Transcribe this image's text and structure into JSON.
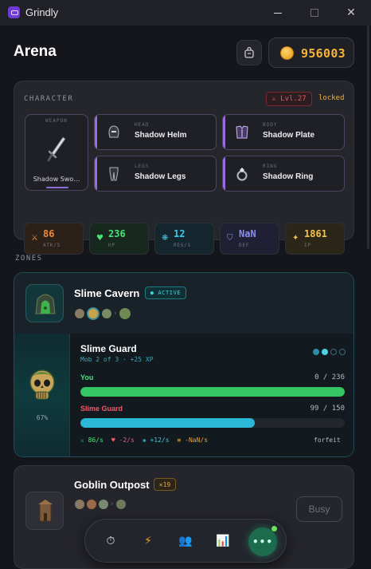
{
  "window": {
    "title": "Grindly",
    "minimize_icon": "minimize-icon",
    "maximize_icon": "maximize-icon",
    "close_glyph": "✕"
  },
  "header": {
    "title": "Arena",
    "coins": "956003",
    "bag_icon": "bag-icon",
    "coin_icon": "coin-icon"
  },
  "character": {
    "section_label": "CHARACTER",
    "level_badge": "⚔ Lvl.27",
    "locked_label": "locked",
    "weapon": {
      "caption": "WEAPON",
      "name": "Shadow Swo…"
    },
    "armor": [
      {
        "caption": "HEAD",
        "name": "Shadow Helm"
      },
      {
        "caption": "BODY",
        "name": "Shadow Plate"
      },
      {
        "caption": "LEGS",
        "name": "Shadow Legs"
      },
      {
        "caption": "RING",
        "name": "Shadow Ring"
      }
    ],
    "stats": [
      {
        "icon": "⚔",
        "value": "86",
        "label": "ATK/S",
        "color": "#f0883a",
        "bg": "#2b2119"
      },
      {
        "icon": "♥",
        "value": "236",
        "label": "HP",
        "color": "#4be07a",
        "bg": "#17281e"
      },
      {
        "icon": "❋",
        "value": "12",
        "label": "REG/S",
        "color": "#3fc8e6",
        "bg": "#15252d"
      },
      {
        "icon": "⛉",
        "value": "NaN",
        "label": "DEF",
        "color": "#8c8cf0",
        "bg": "#1f2033"
      },
      {
        "icon": "✦",
        "value": "1861",
        "label": "IP",
        "color": "#f6c24a",
        "bg": "#2b2617"
      }
    ]
  },
  "zones": {
    "section_label": "ZONES",
    "active_zone": {
      "name": "Slime Cavern",
      "badge": "● ACTIVE",
      "mob_arrow": "›",
      "fight": {
        "enemy_name": "Slime Guard",
        "enemy_sub": "Mob 2 of 3 · +25 XP",
        "enemy_hp_pct_label": "67%",
        "you_label": "You",
        "you_hp": "0 / 236",
        "you_hp_fraction": 1.0,
        "enemy_label": "Slime Guard",
        "enemy_hp": "99 / 150",
        "enemy_hp_fraction": 0.66,
        "rates": [
          {
            "text": "⚔ 86/s",
            "color": "#4be07a"
          },
          {
            "text": "♥ -2/s",
            "color": "#f05a6a"
          },
          {
            "text": "❋ +12/s",
            "color": "#3fc8e6"
          },
          {
            "text": "≡ -NaN/s",
            "color": "#e8a23a"
          }
        ],
        "forfeit_label": "forfeit",
        "progress_dots": [
          "done",
          "current",
          "pending",
          "pending"
        ]
      }
    },
    "next_zone": {
      "name": "Goblin Outpost",
      "badge": "×19",
      "button": "Busy",
      "mob_arrow": "›"
    }
  },
  "dock": {
    "items": [
      {
        "name": "timer-icon",
        "glyph": "⏱"
      },
      {
        "name": "bolt-icon",
        "glyph": "⚡"
      },
      {
        "name": "party-icon",
        "glyph": "👥"
      },
      {
        "name": "stats-icon",
        "glyph": "📊"
      }
    ],
    "more_glyph": "•••"
  }
}
